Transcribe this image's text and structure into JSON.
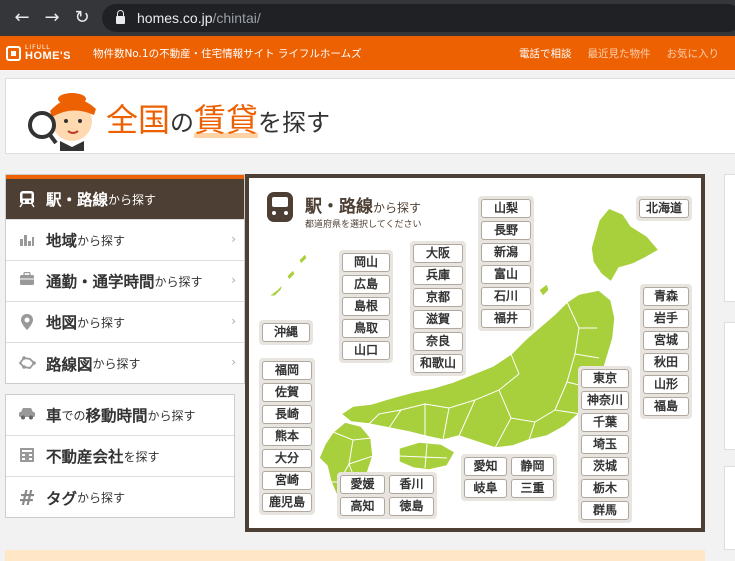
{
  "browser": {
    "back": "←",
    "forward": "→",
    "reload": "↻",
    "url_host": "homes.co.jp",
    "url_path": "/chintai/"
  },
  "header": {
    "logo_small": "LIFULL",
    "logo_big": "HOME'S",
    "tagline": "物件数No.1の不動産・住宅情報サイト ライフルホームズ",
    "links": [
      "電話で相談",
      "最近見た物件",
      "お気に入り"
    ]
  },
  "banner": {
    "title_part1": "全国",
    "title_part2": "の",
    "title_part3": "賃貸",
    "title_part4": "を探す"
  },
  "menu": {
    "items": [
      {
        "main": "駅・路線",
        "sub": "から探す",
        "icon": "train-icon"
      },
      {
        "main": "地域",
        "sub": "から探す",
        "icon": "area-icon"
      },
      {
        "main": "通勤・通学時間",
        "sub": "から探す",
        "icon": "briefcase-icon"
      },
      {
        "main": "地図",
        "sub": "から探す",
        "icon": "map-pin-icon"
      },
      {
        "main": "路線図",
        "sub": "から探す",
        "icon": "route-map-icon"
      }
    ],
    "items2": [
      {
        "main": "車",
        "mid": "での",
        "main2": "移動時間",
        "sub": "から探す",
        "icon": "car-icon"
      },
      {
        "main": "不動産会社",
        "sub": "を探す",
        "icon": "building-icon"
      },
      {
        "main": "タグ",
        "sub": "から探す",
        "icon": "hashtag-icon"
      }
    ]
  },
  "map": {
    "title": "駅・路線",
    "title_sub": "から探す",
    "subtitle": "都道府県を選択してください",
    "hokkaido": [
      "北海道"
    ],
    "tohoku": [
      "青森",
      "岩手",
      "宮城",
      "秋田",
      "山形",
      "福島"
    ],
    "koshinetsu": [
      "山梨",
      "長野",
      "新潟",
      "富山",
      "石川",
      "福井"
    ],
    "kanto": [
      "東京",
      "神奈川",
      "千葉",
      "埼玉",
      "茨城",
      "栃木",
      "群馬"
    ],
    "kinki": [
      "大阪",
      "兵庫",
      "京都",
      "滋賀",
      "奈良",
      "和歌山"
    ],
    "chugoku": [
      "岡山",
      "広島",
      "島根",
      "鳥取",
      "山口"
    ],
    "okinawa": [
      "沖縄"
    ],
    "kyushu": [
      "福岡",
      "佐賀",
      "長崎",
      "熊本",
      "大分",
      "宮崎",
      "鹿児島"
    ],
    "shikoku": [
      "愛媛",
      "香川",
      "高知",
      "徳島"
    ],
    "tokai": [
      "愛知",
      "静岡",
      "岐阜",
      "三重"
    ]
  },
  "colors": {
    "brand_orange": "#ed6103",
    "brown": "#4d3f33",
    "map_green": "#a8cf3c"
  }
}
